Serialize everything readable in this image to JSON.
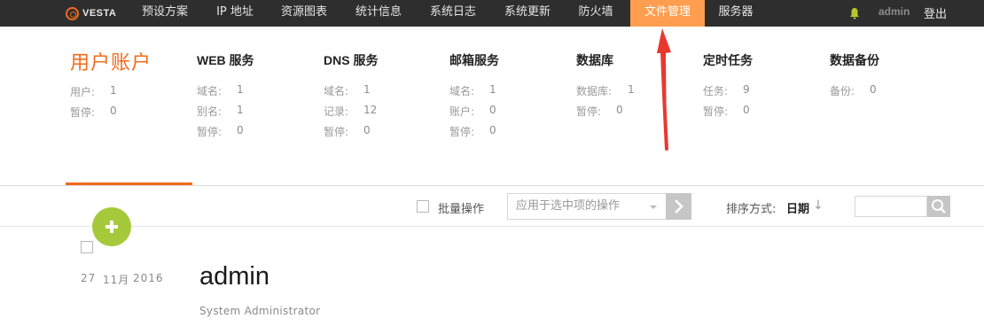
{
  "topnav": {
    "logo_text": "VESTA",
    "items": [
      "预设方案",
      "IP 地址",
      "资源图表",
      "统计信息",
      "系统日志",
      "系统更新",
      "防火墙",
      "文件管理",
      "服务器"
    ],
    "active_index": 7,
    "user": "admin",
    "logout": "登出",
    "active_color": "#ff9e4f",
    "bar_color": "#2e2e2e",
    "bell_icon": "bell-icon"
  },
  "stats": {
    "user": {
      "title": "用户账户",
      "rows": [
        {
          "k": "用户:",
          "v": "1"
        },
        {
          "k": "暂停:",
          "v": "0"
        }
      ]
    },
    "web": {
      "title": "WEB 服务",
      "rows": [
        {
          "k": "域名:",
          "v": "1"
        },
        {
          "k": "别名:",
          "v": "1"
        },
        {
          "k": "暂停:",
          "v": "0"
        }
      ]
    },
    "dns": {
      "title": "DNS 服务",
      "rows": [
        {
          "k": "域名:",
          "v": "1"
        },
        {
          "k": "记录:",
          "v": "12"
        },
        {
          "k": "暂停:",
          "v": "0"
        }
      ]
    },
    "mail": {
      "title": "邮箱服务",
      "rows": [
        {
          "k": "域名:",
          "v": "1"
        },
        {
          "k": "账户:",
          "v": "0"
        },
        {
          "k": "暂停:",
          "v": "0"
        }
      ]
    },
    "db": {
      "title": "数据库",
      "rows": [
        {
          "k": "数据库:",
          "v": "1"
        },
        {
          "k": "暂停:",
          "v": "0"
        }
      ]
    },
    "cron": {
      "title": "定时任务",
      "rows": [
        {
          "k": "任务:",
          "v": "9"
        },
        {
          "k": "暂停:",
          "v": "0"
        }
      ]
    },
    "backup": {
      "title": "数据备份",
      "rows": [
        {
          "k": "备份:",
          "v": "0"
        }
      ]
    }
  },
  "toolbar": {
    "bulk_label": "批量操作",
    "select_value": "应用于选中项的操作",
    "apply_icon": "chevron-right-icon",
    "sort_label": "排序方式:",
    "sort_value": "日期",
    "sort_icon": "arrow-down-icon",
    "search_icon": "search-icon"
  },
  "add_icon": "plus-icon",
  "item": {
    "day": "27",
    "month": "11月",
    "year": "2016",
    "title": "admin",
    "subtitle": "System Administrator"
  },
  "colors": {
    "accent": "#f26b1d",
    "add": "#a6c93b",
    "annotation": "#e8392f"
  }
}
